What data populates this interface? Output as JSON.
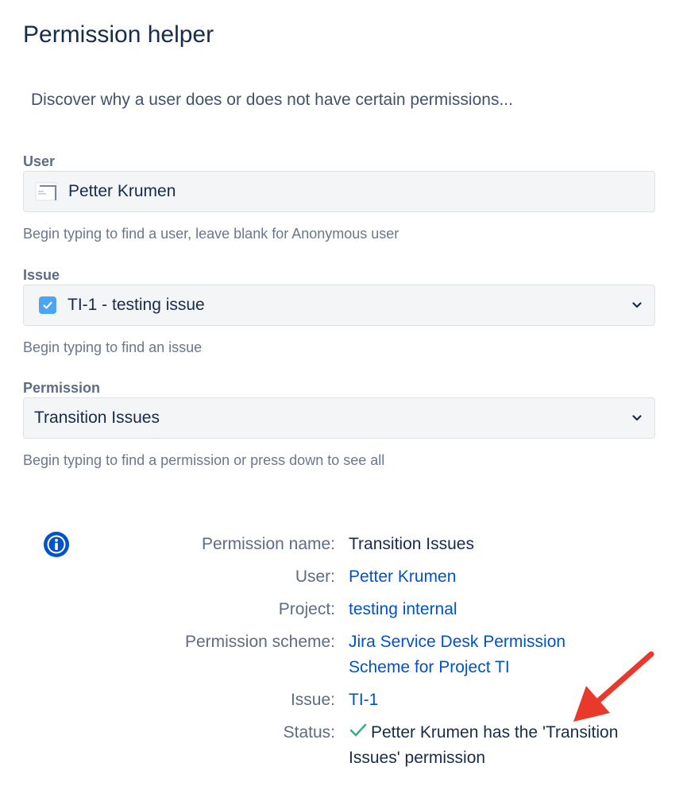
{
  "page": {
    "title": "Permission helper",
    "intro": "Discover why a user does or does not have certain permissions..."
  },
  "form": {
    "user": {
      "label": "User",
      "value": "Petter Krumen",
      "help": "Begin typing to find a user, leave blank for Anonymous user"
    },
    "issue": {
      "label": "Issue",
      "value": "TI-1 - testing issue",
      "help": "Begin typing to find an issue"
    },
    "permission": {
      "label": "Permission",
      "value": "Transition Issues",
      "help": "Begin typing to find a permission or press down to see all"
    }
  },
  "result": {
    "permission_name_label": "Permission name:",
    "permission_name_value": "Transition Issues",
    "user_label": "User:",
    "user_value": "Petter Krumen",
    "project_label": "Project:",
    "project_value": "testing internal",
    "scheme_label": "Permission scheme:",
    "scheme_value": "Jira Service Desk Permission Scheme for Project TI",
    "issue_label": "Issue:",
    "issue_value": "TI-1",
    "status_label": "Status:",
    "status_value": "Petter Krumen has the 'Transition Issues' permission"
  },
  "colors": {
    "link": "#0052CC",
    "success": "#36B37E",
    "info": "#0052CC",
    "annotation_arrow": "#E8392B",
    "checkbox": "#4CA4F5"
  },
  "icons": [
    "avatar-icon",
    "checkbox-icon",
    "chevron-down-icon",
    "info-icon",
    "checkmark-icon",
    "arrow-annotation"
  ]
}
